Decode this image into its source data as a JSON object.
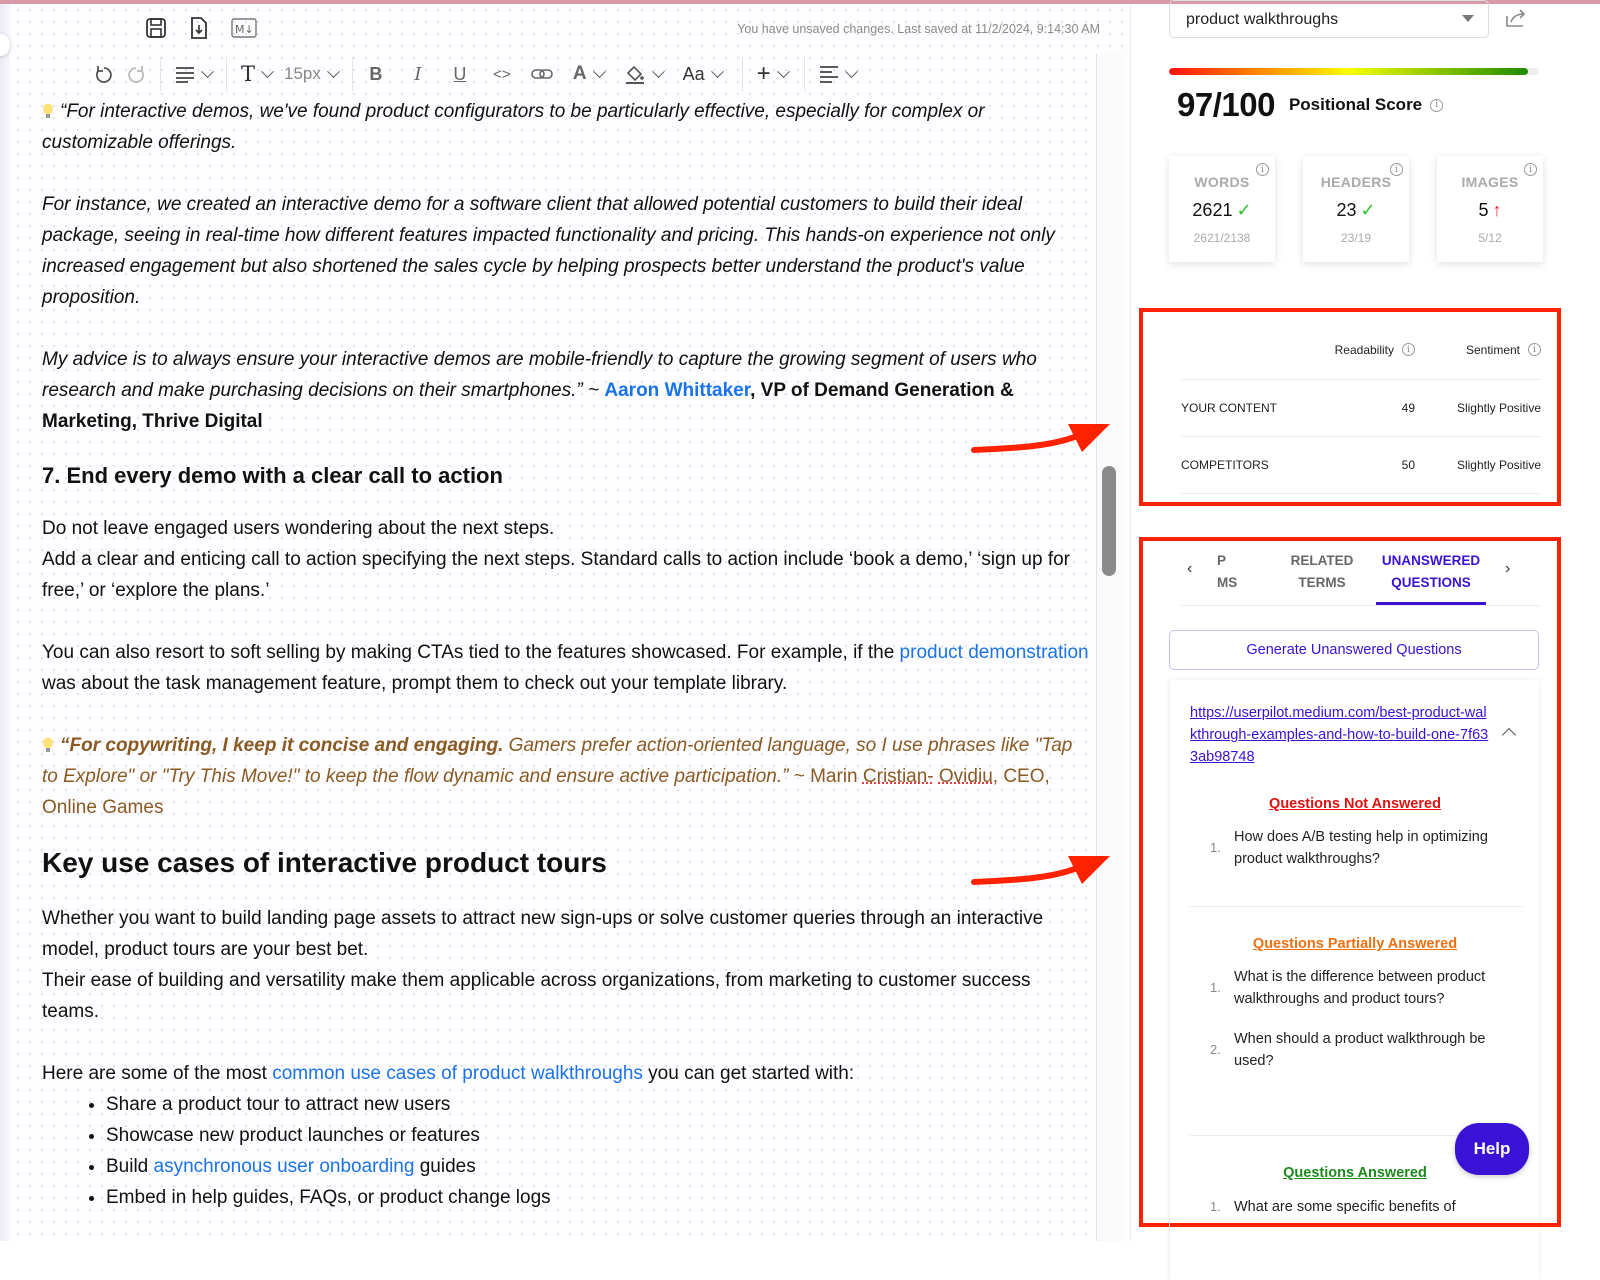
{
  "editor": {
    "file_tools": [
      {
        "icon": "save-icon"
      },
      {
        "icon": "download-file-icon"
      },
      {
        "icon": "markdown-download-icon",
        "label": "M↓"
      }
    ],
    "save_status": "You have unsaved changes. Last saved at 11/2/2024, 9:14:30 AM",
    "toolbar": {
      "font_size": "15px",
      "text_style_label": "T",
      "case_label": "Aa",
      "bold": "B",
      "italic": "I",
      "underline": "U",
      "code": "<>",
      "font_color": "A",
      "insert": "+"
    },
    "content": {
      "quote1_line": "“For interactive demos, we've found product configurators to be particularly effective, especially for complex or customizable offerings.",
      "quote1_p2": "For instance, we created an interactive demo for a software client that allowed potential customers to build their ideal package, seeing in real-time how different features impacted functionality and pricing. This hands-on experience not only increased engagement but also shortened the sales cycle by helping prospects better understand the product's value proposition.",
      "quote1_p3": "My advice is to always ensure your interactive demos are mobile-friendly to capture the growing segment of users who research and make purchasing decisions on their smartphones.” ~ ",
      "quote1_author": "Aaron Whittaker",
      "quote1_role": ", VP of Demand Generation & Marketing, Thrive Digital",
      "heading7": "7. End every demo with a clear call to action",
      "cta_p1": "Do not leave engaged users wondering about the next steps.",
      "cta_p2": "Add a clear and enticing call to action specifying the next steps. Standard calls to action include ‘book a demo,’ ‘sign up for free,’ or ‘explore the plans.’",
      "cta_p3_before": "You can also resort to soft selling by making CTAs tied to the features showcased. For example, if the ",
      "cta_p3_link": "product demonstration",
      "cta_p3_after": " was about the task management feature, prompt them to check out your template library.",
      "quote2_lead": "“For copywriting, I keep it concise and engaging.",
      "quote2_rest": " Gamers prefer action-oriented language, so I use phrases like \"Tap to Explore\" or \"Try This Move!\" to keep the flow dynamic and ensure active participation.” ",
      "quote2_author_pre": "~ Marin ",
      "quote2_author_spell1": "Cristian-",
      "quote2_author_spell2": "Ovidiu",
      "quote2_author_post": ", CEO, Online Games",
      "heading_key": "Key use cases of interactive product tours",
      "key_p1": "Whether you want to build landing page assets to attract new sign-ups or solve customer queries through an interactive model, product tours are your best bet.",
      "key_p2": "Their ease of building and versatility make them applicable across organizations, from marketing to customer success teams.",
      "key_p3_before": "Here are some of the most ",
      "key_p3_link": "common use cases of product walkthroughs",
      "key_p3_after": " you can get started with:",
      "bullets": [
        {
          "text": "Share a product tour to attract new users"
        },
        {
          "text": "Showcase new product launches or features"
        },
        {
          "before": "Build ",
          "link": "asynchronous user onboarding",
          "after": " guides"
        },
        {
          "text": "Embed in help guides, FAQs, or product change logs"
        }
      ]
    }
  },
  "panel": {
    "keyword": "product walkthroughs",
    "score": {
      "value": 97,
      "max": 100,
      "display": "97/100",
      "label": "Positional Score",
      "fill_fraction": 0.97
    },
    "stats": [
      {
        "title": "WORDS",
        "value": "2621",
        "status": "ok",
        "ratio": "2621/2138"
      },
      {
        "title": "HEADERS",
        "value": "23",
        "status": "ok",
        "ratio": "23/19"
      },
      {
        "title": "IMAGES",
        "value": "5",
        "status": "up",
        "ratio": "5/12"
      }
    ],
    "metrics": {
      "col_readability": "Readability",
      "col_sentiment": "Sentiment",
      "rows": [
        {
          "name": "YOUR CONTENT",
          "readability": "49",
          "sentiment": "Slightly Positive"
        },
        {
          "name": "COMPETITORS",
          "readability": "50",
          "sentiment": "Slightly Positive"
        }
      ]
    },
    "tabs": [
      {
        "line1": "P",
        "line2": "MS",
        "partial": true
      },
      {
        "line1": "RELATED",
        "line2": "TERMS"
      },
      {
        "line1": "UNANSWERED",
        "line2": "QUESTIONS",
        "active": true
      }
    ],
    "generate_button": "Generate Unanswered Questions",
    "questions": {
      "url": "https://userpilot.medium.com/best-product-walkthrough-examples-and-how-to-build-one-7f633ab98748",
      "not_answered_title": "Questions Not Answered",
      "not_answered": [
        "How does A/B testing help in optimizing product walkthroughs?"
      ],
      "partial_title": "Questions Partially Answered",
      "partial": [
        "What is the difference between product walkthroughs and product tours?",
        "When should a product walkthrough be used?"
      ],
      "answered_title": "Questions Answered",
      "answered": [
        "What are some specific benefits of"
      ]
    },
    "help_button": "Help",
    "colors": {
      "accent": "#3a12d6",
      "not_answered": "#e01010",
      "partial": "#f07010",
      "answered": "#1e8a1e",
      "annotation": "#ff2200"
    }
  }
}
